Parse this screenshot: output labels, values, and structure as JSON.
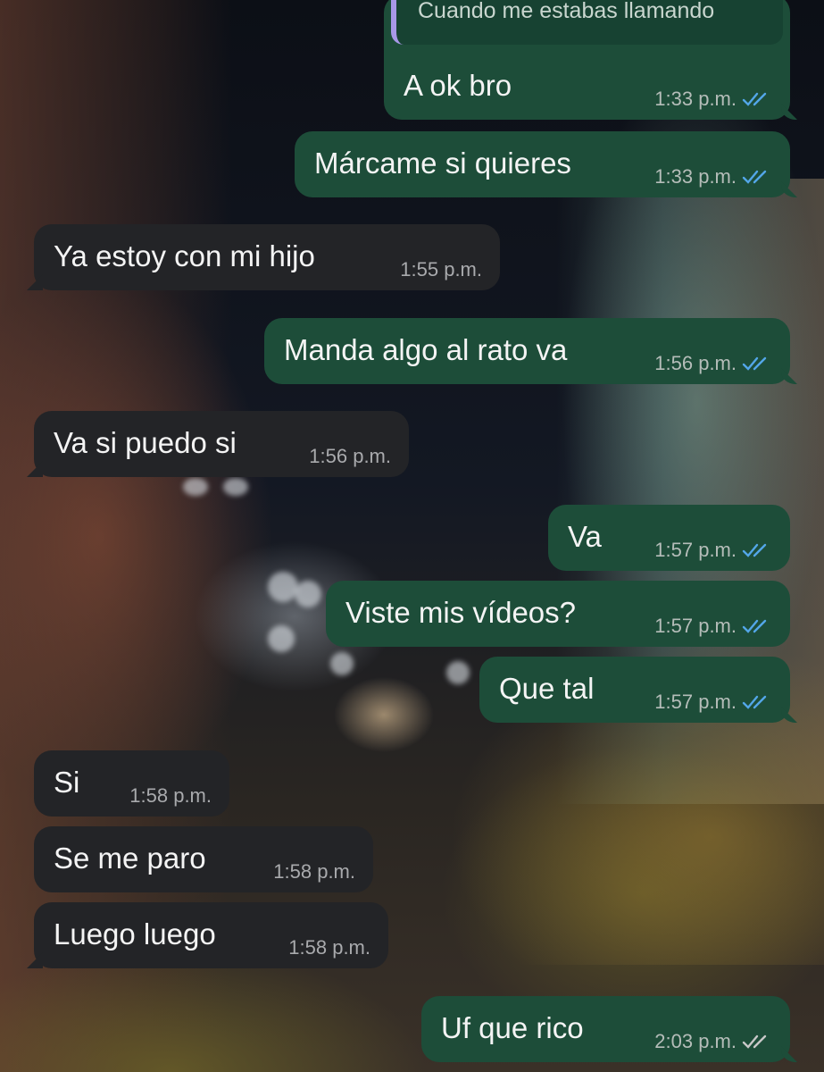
{
  "quoted_reply": {
    "text": "Cuando me estabas llamando"
  },
  "colors": {
    "outgoing_bubble": "#1d4d39",
    "incoming_bubble": "#232427",
    "read_ticks": "#53a6e8",
    "sent_ticks": "#c8c8c8"
  },
  "messages": [
    {
      "id": "m1",
      "direction": "outgoing",
      "text": "A ok bro",
      "time": "1:33 p.m.",
      "status": "read",
      "has_quote": true
    },
    {
      "id": "m2",
      "direction": "outgoing",
      "text": "Márcame si quieres",
      "time": "1:33 p.m.",
      "status": "read"
    },
    {
      "id": "m3",
      "direction": "incoming",
      "text": "Ya estoy con mi hijo",
      "time": "1:55 p.m."
    },
    {
      "id": "m4",
      "direction": "outgoing",
      "text": "Manda algo al rato va",
      "time": "1:56 p.m.",
      "status": "read"
    },
    {
      "id": "m5",
      "direction": "incoming",
      "text": "Va si puedo si",
      "time": "1:56 p.m."
    },
    {
      "id": "m6",
      "direction": "outgoing",
      "text": "Va",
      "time": "1:57 p.m.",
      "status": "read"
    },
    {
      "id": "m7",
      "direction": "outgoing",
      "text": "Viste mis vídeos?",
      "time": "1:57 p.m.",
      "status": "read"
    },
    {
      "id": "m8",
      "direction": "outgoing",
      "text": "Que tal",
      "time": "1:57 p.m.",
      "status": "read"
    },
    {
      "id": "m9",
      "direction": "incoming",
      "text": "Si",
      "time": "1:58 p.m."
    },
    {
      "id": "m10",
      "direction": "incoming",
      "text": "Se me paro",
      "time": "1:58 p.m."
    },
    {
      "id": "m11",
      "direction": "incoming",
      "text": "Luego luego",
      "time": "1:58 p.m."
    },
    {
      "id": "m12",
      "direction": "outgoing",
      "text": "Uf que rico",
      "time": "2:03 p.m.",
      "status": "delivered"
    }
  ]
}
